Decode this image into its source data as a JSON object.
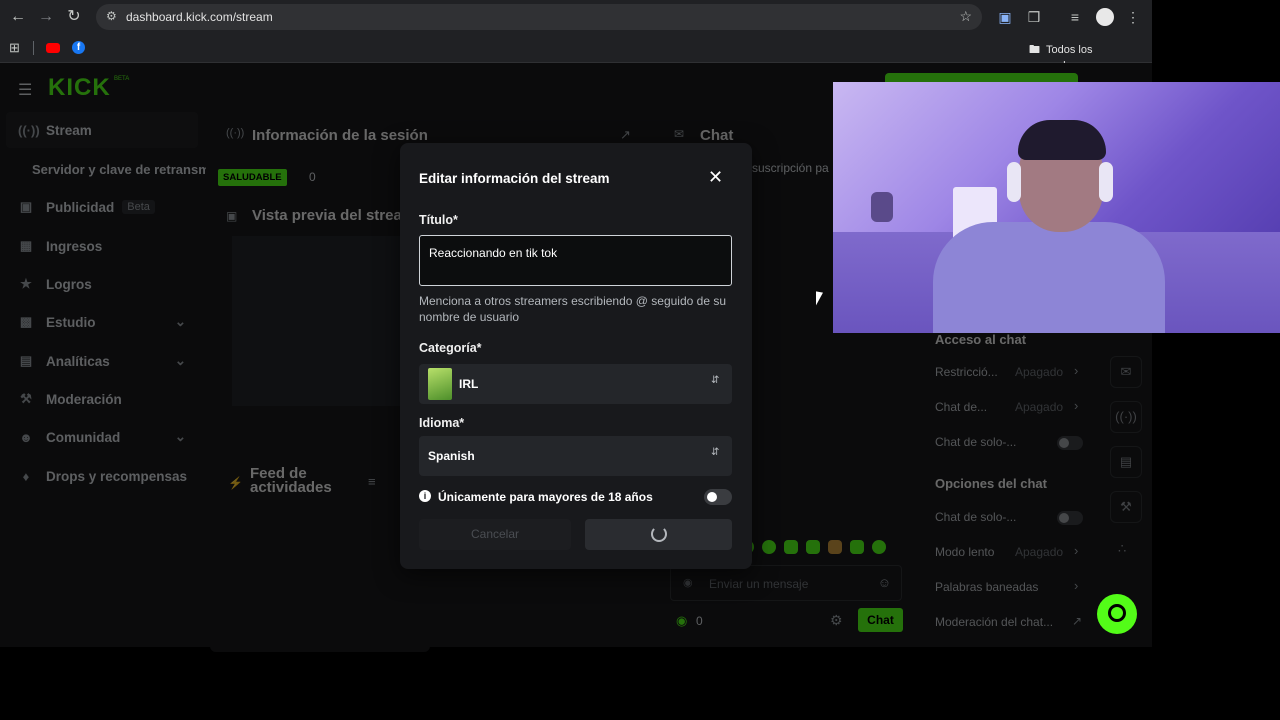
{
  "browser": {
    "url": "dashboard.kick.com/stream",
    "bookmarks_all": "Todos los marcadores"
  },
  "header": {
    "logo": "KICK",
    "logo_badge": "BETA"
  },
  "sidebar": {
    "items": [
      {
        "label": "Stream",
        "icon": "broadcast-icon"
      },
      {
        "label": "Servidor y clave de retransmisión",
        "icon": ""
      },
      {
        "label": "Publicidad",
        "icon": "ads-icon",
        "badge": "Beta"
      },
      {
        "label": "Ingresos",
        "icon": "bank-icon"
      },
      {
        "label": "Logros",
        "icon": "trophy-icon"
      },
      {
        "label": "Estudio",
        "icon": "studio-icon"
      },
      {
        "label": "Analíticas",
        "icon": "chart-icon"
      },
      {
        "label": "Moderación",
        "icon": "wrench-icon"
      },
      {
        "label": "Comunidad",
        "icon": "users-icon"
      },
      {
        "label": "Drops y recompensas",
        "icon": "gift-icon"
      }
    ]
  },
  "session": {
    "title": "Información de la sesión",
    "health_badge": "SALUDABLE",
    "viewers": "0"
  },
  "preview": {
    "title": "Vista previa del stream"
  },
  "feed": {
    "title": "Feed de actividades"
  },
  "chat": {
    "title": "Chat",
    "sub_notice": "suscripción pa",
    "input_placeholder": "Enviar un mensaje",
    "count": "0",
    "send_label": "Chat"
  },
  "chat_settings": {
    "access_heading": "Acceso al chat",
    "rows_access": [
      {
        "label": "Restricció...",
        "value": "Apagado"
      },
      {
        "label": "Chat de...",
        "value": "Apagado"
      },
      {
        "label": "Chat de solo-...",
        "value": ""
      }
    ],
    "options_heading": "Opciones del chat",
    "rows_options": [
      {
        "label": "Chat de solo-...",
        "value": ""
      },
      {
        "label": "Modo lento",
        "value": "Apagado"
      },
      {
        "label": "Palabras baneadas",
        "value": ""
      },
      {
        "label": "Moderación del chat...",
        "value": ""
      }
    ]
  },
  "modal": {
    "title": "Editar información del stream",
    "title_label": "Título*",
    "title_value": "Reaccionando en tik tok",
    "title_hint": "Menciona a otros streamers escribiendo @ seguido de su nombre de usuario",
    "category_label": "Categoría*",
    "category_value": "IRL",
    "language_label": "Idioma*",
    "language_value": "Spanish",
    "adult_label": "Únicamente para mayores de 18 años",
    "cancel_label": "Cancelar"
  },
  "colors": {
    "accent": "#53fc18",
    "modal_bg": "#18191c",
    "page_bg": "#0b0b0c"
  }
}
